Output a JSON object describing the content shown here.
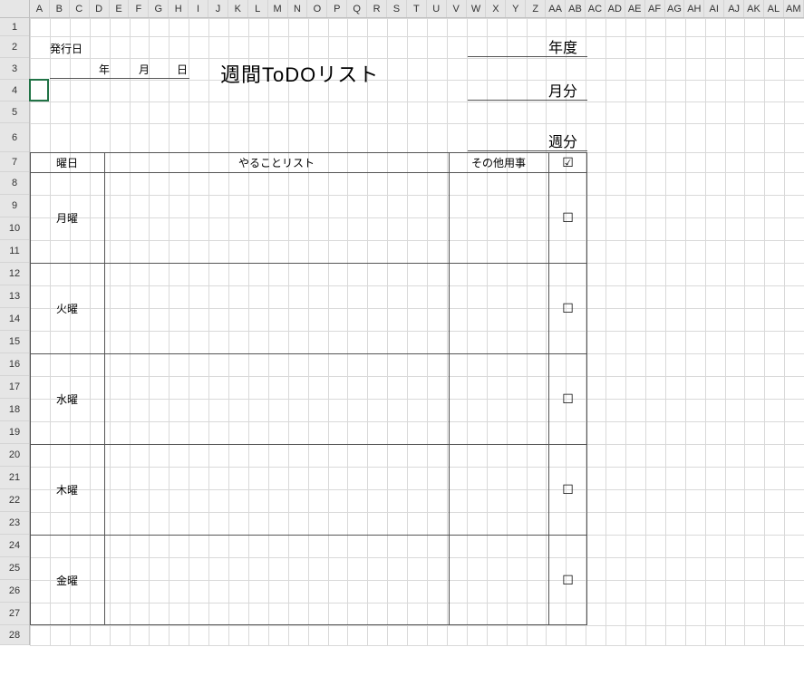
{
  "columns": [
    "A",
    "B",
    "C",
    "D",
    "E",
    "F",
    "G",
    "H",
    "I",
    "J",
    "K",
    "L",
    "M",
    "N",
    "O",
    "P",
    "Q",
    "R",
    "S",
    "T",
    "U",
    "V",
    "W",
    "X",
    "Y",
    "Z",
    "AA",
    "AB",
    "AC",
    "AD",
    "AE",
    "AF",
    "AG",
    "AH",
    "AI",
    "AJ",
    "AK",
    "AL",
    "AM"
  ],
  "rows": {
    "count": 28,
    "heights": {
      "1": 20,
      "2": 24,
      "3": 24,
      "4": 24,
      "5": 24,
      "6": 32,
      "7": 22,
      "8": 25,
      "9": 25,
      "10": 25,
      "11": 25,
      "12": 25,
      "13": 25,
      "14": 25,
      "15": 25,
      "16": 25,
      "17": 25,
      "18": 25,
      "19": 25,
      "20": 25,
      "21": 25,
      "22": 25,
      "23": 25,
      "24": 25,
      "25": 25,
      "26": 25,
      "27": 25,
      "28": 22
    }
  },
  "doc": {
    "issue_label": "発行日",
    "date_year": "年",
    "date_month": "月",
    "date_day": "日",
    "title": "週間ToDOリスト",
    "fiscal_year": "年度",
    "month_part": "月分",
    "week_part": "週分",
    "header_day": "曜日",
    "header_tasks": "やることリスト",
    "header_other": "その他用事",
    "header_check": "☑",
    "days": [
      "月曜",
      "火曜",
      "水曜",
      "木曜",
      "金曜"
    ],
    "checkbox": "☐"
  },
  "col_width": 21.9,
  "active_cell": "A4"
}
